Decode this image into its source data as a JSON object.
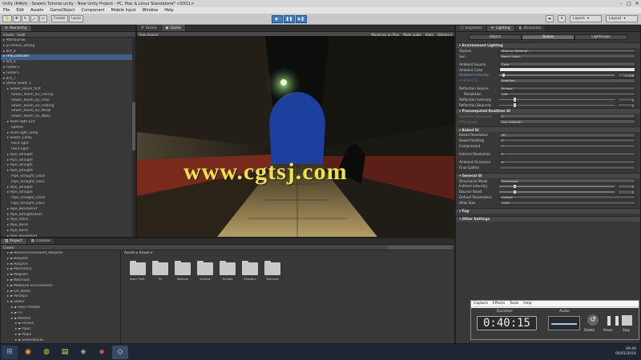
{
  "window": {
    "title": "Unity (64bit) - Sewers Tutorial.unity - New Unity Project - PC, Mac & Linux Standalone* <DX11>"
  },
  "menu": [
    "File",
    "Edit",
    "Assets",
    "GameObject",
    "Component",
    "Mobile Input",
    "Window",
    "Help"
  ],
  "toolbar": {
    "center_label": "Center",
    "local_label": "Local",
    "layers_label": "Layers",
    "layout_label": "Layout"
  },
  "hierarchy": {
    "tab": "Hierarchy",
    "create": "Create",
    "search": "Q▾All",
    "items": [
      {
        "t": "Afterburner",
        "i": 0,
        "s": false
      },
      {
        "t": "ps-Helios_Sitting",
        "i": 0,
        "s": false
      },
      {
        "t": "dirt_4",
        "i": 0,
        "s": false
      },
      {
        "t": "FPSController",
        "i": 0,
        "s": true
      },
      {
        "t": "dirt_6",
        "i": 0,
        "s": false
      },
      {
        "t": "Footer3",
        "i": 0,
        "s": false
      },
      {
        "t": "Footer1",
        "i": 0,
        "s": false
      },
      {
        "t": "dirt_7",
        "i": 0,
        "s": false
      },
      {
        "t": "Demo Sewer 1",
        "i": 0,
        "s": false
      },
      {
        "t": "Sewer_Room_first",
        "i": 1,
        "s": false
      },
      {
        "t": "Sewer_Room_02_Ceiling",
        "i": 2,
        "s": false
      },
      {
        "t": "Sewer_Room_02_Floor",
        "i": 2,
        "s": false
      },
      {
        "t": "Sewer_Room_02_Grating",
        "i": 2,
        "s": false
      },
      {
        "t": "Sewer_Room_02_Metal",
        "i": 2,
        "s": false
      },
      {
        "t": "Sewer_Room_02_Walls",
        "i": 2,
        "s": false
      },
      {
        "t": "Point light Exit",
        "i": 1,
        "s": false
      },
      {
        "t": "Sphere",
        "i": 2,
        "s": false
      },
      {
        "t": "Point light Lamp",
        "i": 1,
        "s": false
      },
      {
        "t": "Sewer_Lamp",
        "i": 1,
        "s": false
      },
      {
        "t": "Point light",
        "i": 2,
        "s": false
      },
      {
        "t": "Point light",
        "i": 2,
        "s": false
      },
      {
        "t": "Pipe_Straight",
        "i": 1,
        "s": false
      },
      {
        "t": "Pipe_Straight",
        "i": 1,
        "s": false
      },
      {
        "t": "Pipe_Straight",
        "i": 1,
        "s": false
      },
      {
        "t": "Pipe_Straight",
        "i": 1,
        "s": false
      },
      {
        "t": "Pipe_Straight_LOD0",
        "i": 2,
        "s": false
      },
      {
        "t": "Pipe_Straight_LOD1",
        "i": 2,
        "s": false
      },
      {
        "t": "Pipe_Straight",
        "i": 1,
        "s": false
      },
      {
        "t": "Pipe_Straight",
        "i": 1,
        "s": false
      },
      {
        "t": "Pipe_Straight_LOD0",
        "i": 2,
        "s": false
      },
      {
        "t": "Pipe_Straight_LOD1",
        "i": 2,
        "s": false
      },
      {
        "t": "Pipe_BendShort",
        "i": 1,
        "s": false
      },
      {
        "t": "Pipe_StraightShort",
        "i": 1,
        "s": false
      },
      {
        "t": "Pipe_Valve",
        "i": 1,
        "s": false
      },
      {
        "t": "Pipe_Bend",
        "i": 1,
        "s": false
      },
      {
        "t": "Pipe_Bend",
        "i": 1,
        "s": false
      },
      {
        "t": "Pipe_BendShort",
        "i": 1,
        "s": false
      },
      {
        "t": "Pipe_BendShort",
        "i": 1,
        "s": false
      }
    ]
  },
  "scene_tabs": {
    "scene": "Scene",
    "game": "Game",
    "free_aspect": "Free Aspect",
    "maximize": "Maximize on Play",
    "mute": "Mute audio",
    "stats": "Stats",
    "gizmos": "Gizmos ▾"
  },
  "watermark": "www.cgtsj.com",
  "project": {
    "tabs": [
      "Project",
      "Console"
    ],
    "create": "Create",
    "tree": [
      {
        "t": "HorrorEnvironment_Hospital",
        "i": 1
      },
      {
        "t": "Hospital",
        "i": 1
      },
      {
        "t": "Hospitle",
        "i": 1
      },
      {
        "t": "Machinery",
        "i": 1
      },
      {
        "t": "Magazin",
        "i": 1
      },
      {
        "t": "Materials",
        "i": 1
      },
      {
        "t": "Medieval Environment",
        "i": 1
      },
      {
        "t": "OR_Room",
        "i": 1
      },
      {
        "t": "PostApo",
        "i": 1
      },
      {
        "t": "Sewer",
        "i": 1
      },
      {
        "t": "ewer Prefabs",
        "i": 2
      },
      {
        "t": "FX",
        "i": 2
      },
      {
        "t": "Meshes",
        "i": 2
      },
      {
        "t": "Fences",
        "i": 3
      },
      {
        "t": "Pipes",
        "i": 3
      },
      {
        "t": "Props",
        "i": 3
      },
      {
        "t": "SewerBlocks",
        "i": 3
      }
    ],
    "breadcrumb": "Assets ▸ Sewer ▸",
    "folders": [
      "ewer Pref..",
      "FX",
      "Meshes",
      "Scenes",
      "Scripts",
      "Shaders",
      "Textures"
    ]
  },
  "inspector": {
    "tabs": [
      "Inspector",
      "Lighting",
      "Occlusion"
    ],
    "subtabs": [
      "Object",
      "Scene",
      "Lightmaps"
    ],
    "rows": [
      {
        "k": "hdr",
        "l": "Environment Lighting"
      },
      {
        "k": "val",
        "l": "Skybox",
        "v": "Missing (Material)"
      },
      {
        "k": "val",
        "l": "Sun",
        "v": "None (Light)"
      },
      {
        "k": "gap"
      },
      {
        "k": "val",
        "l": "Ambient Source",
        "v": "Color"
      },
      {
        "k": "light",
        "l": "Ambient Color",
        "v": ""
      },
      {
        "k": "slider",
        "l": "Ambient Intensity",
        "n": "0.226",
        "blue": true
      },
      {
        "k": "val",
        "l": "Ambient GI",
        "v": "Realtime",
        "dis": true
      },
      {
        "k": "gap"
      },
      {
        "k": "val",
        "l": "Reflection Source",
        "v": "Skybox"
      },
      {
        "k": "val",
        "l": "Resolution",
        "v": "128",
        "sub": true
      },
      {
        "k": "slider",
        "l": "Reflection Intensity",
        "n": "1"
      },
      {
        "k": "slider",
        "l": "Reflection Bounces",
        "n": "1"
      },
      {
        "k": "hdr",
        "l": "Precomputed Realtime GI"
      },
      {
        "k": "val",
        "l": "Realtime Resolution",
        "v": "2",
        "dis": true
      },
      {
        "k": "val",
        "l": "CPU Usage",
        "v": "Low (default)",
        "dis": true
      },
      {
        "k": "gap"
      },
      {
        "k": "hdr",
        "l": "Baked GI"
      },
      {
        "k": "val",
        "l": "Baked Resolution",
        "v": "40"
      },
      {
        "k": "val",
        "l": "Baked Padding",
        "v": "2"
      },
      {
        "k": "val",
        "l": "Compressed",
        "v": "✓"
      },
      {
        "k": "gap"
      },
      {
        "k": "val",
        "l": "Indirect Resolution",
        "v": "2"
      },
      {
        "k": "gap"
      },
      {
        "k": "val",
        "l": "Ambient Occlusion",
        "v": "0"
      },
      {
        "k": "val",
        "l": "Final Gather",
        "v": ""
      },
      {
        "k": "gap"
      },
      {
        "k": "hdr",
        "l": "General GI"
      },
      {
        "k": "val",
        "l": "Directional Mode",
        "v": "Directional"
      },
      {
        "k": "slider",
        "l": "Indirect Intensity",
        "n": "1"
      },
      {
        "k": "slider",
        "l": "Bounce Boost",
        "n": "1"
      },
      {
        "k": "val",
        "l": "Default Parameters",
        "v": "Default"
      },
      {
        "k": "val",
        "l": "Atlas Size",
        "v": "1024"
      },
      {
        "k": "gap"
      },
      {
        "k": "hdr",
        "l": "Fog"
      },
      {
        "k": "gap"
      },
      {
        "k": "hdr",
        "l": "Other Settings"
      }
    ],
    "units": {
      "texels": "texels per unit",
      "texels2": "texels"
    }
  },
  "recorder": {
    "menu": [
      "Capture",
      "Effects",
      "Tools",
      "Help"
    ],
    "duration_label": "Duration",
    "audio_label": "Audio",
    "time": "0:40:15",
    "delete": "Delete",
    "pause": "Pause",
    "stop": "Stop"
  },
  "tray": {
    "time": "09:40",
    "date": "06/01/2016"
  }
}
